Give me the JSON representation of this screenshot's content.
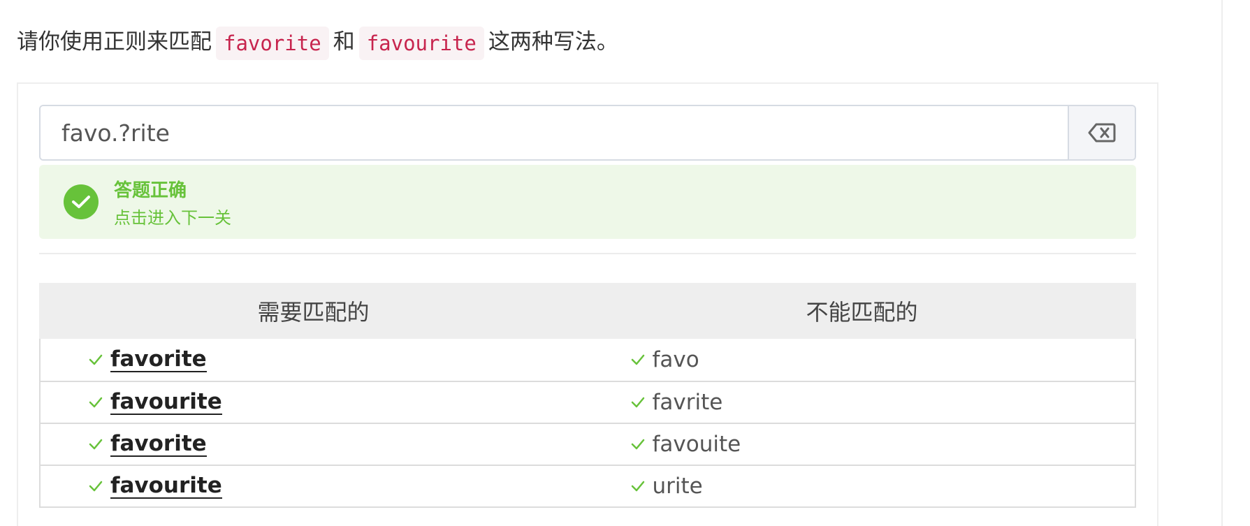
{
  "prompt": {
    "before": "请你使用正则来匹配",
    "code1": "favorite",
    "connector": "和",
    "code2": "favourite",
    "after": "这两种写法。"
  },
  "regex_input": {
    "value": "favo.?rite"
  },
  "clear_button": {
    "icon": "backspace-icon"
  },
  "result": {
    "icon": "check-circle-icon",
    "title": "答题正确",
    "subtitle": "点击进入下一关"
  },
  "table": {
    "headers": [
      "需要匹配的",
      "不能匹配的"
    ],
    "should_match": [
      "favorite",
      "favourite",
      "favorite",
      "favourite"
    ],
    "should_not_match": [
      "favo",
      "favrite",
      "favouite",
      "urite"
    ]
  },
  "colors": {
    "success": "#67c23a",
    "success_bg": "#eef8e8",
    "code": "#c7254e",
    "code_bg": "#f9f2f4"
  }
}
